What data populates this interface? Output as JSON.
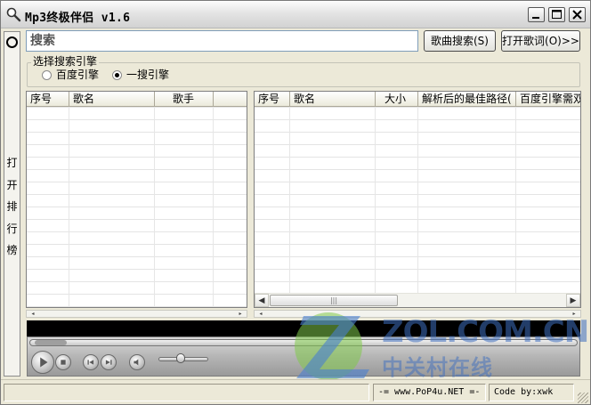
{
  "window": {
    "title": "Mp3终极伴侣 v1.6",
    "controls": {
      "minimize": "minimize",
      "maximize": "maximize",
      "close": "close"
    }
  },
  "sidebar": {
    "rank_button_label": "打开排行榜"
  },
  "search": {
    "placeholder": "搜索",
    "value": "",
    "search_button": "歌曲搜索(S)",
    "lyrics_button": "打开歌词(O)>>"
  },
  "engine": {
    "legend": "选择搜索引擎",
    "options": [
      {
        "label": "百度引擎",
        "selected": false
      },
      {
        "label": "一搜引擎",
        "selected": true
      }
    ]
  },
  "left_list": {
    "columns": [
      "序号",
      "歌名",
      "歌手"
    ],
    "rows": []
  },
  "right_list": {
    "columns": [
      "序号",
      "歌名",
      "大小",
      "解析后的最佳路径(",
      "百度引擎需双"
    ],
    "rows": []
  },
  "player": {
    "buttons": [
      "play-icon",
      "stop-icon",
      "previous-icon",
      "next-icon",
      "volume-icon"
    ]
  },
  "watermark": {
    "latin": "ZOL.COM.CN",
    "chinese": "中关村在线"
  },
  "status": {
    "main": "",
    "site": "-= www.PoP4u.NET =-",
    "author": "Code by:xwk"
  },
  "colors": {
    "listview_bg": "#ffffff",
    "window_bg": "#ece9d8",
    "watermark_green": "#6abf3a",
    "watermark_blue": "#3f6fbf"
  }
}
